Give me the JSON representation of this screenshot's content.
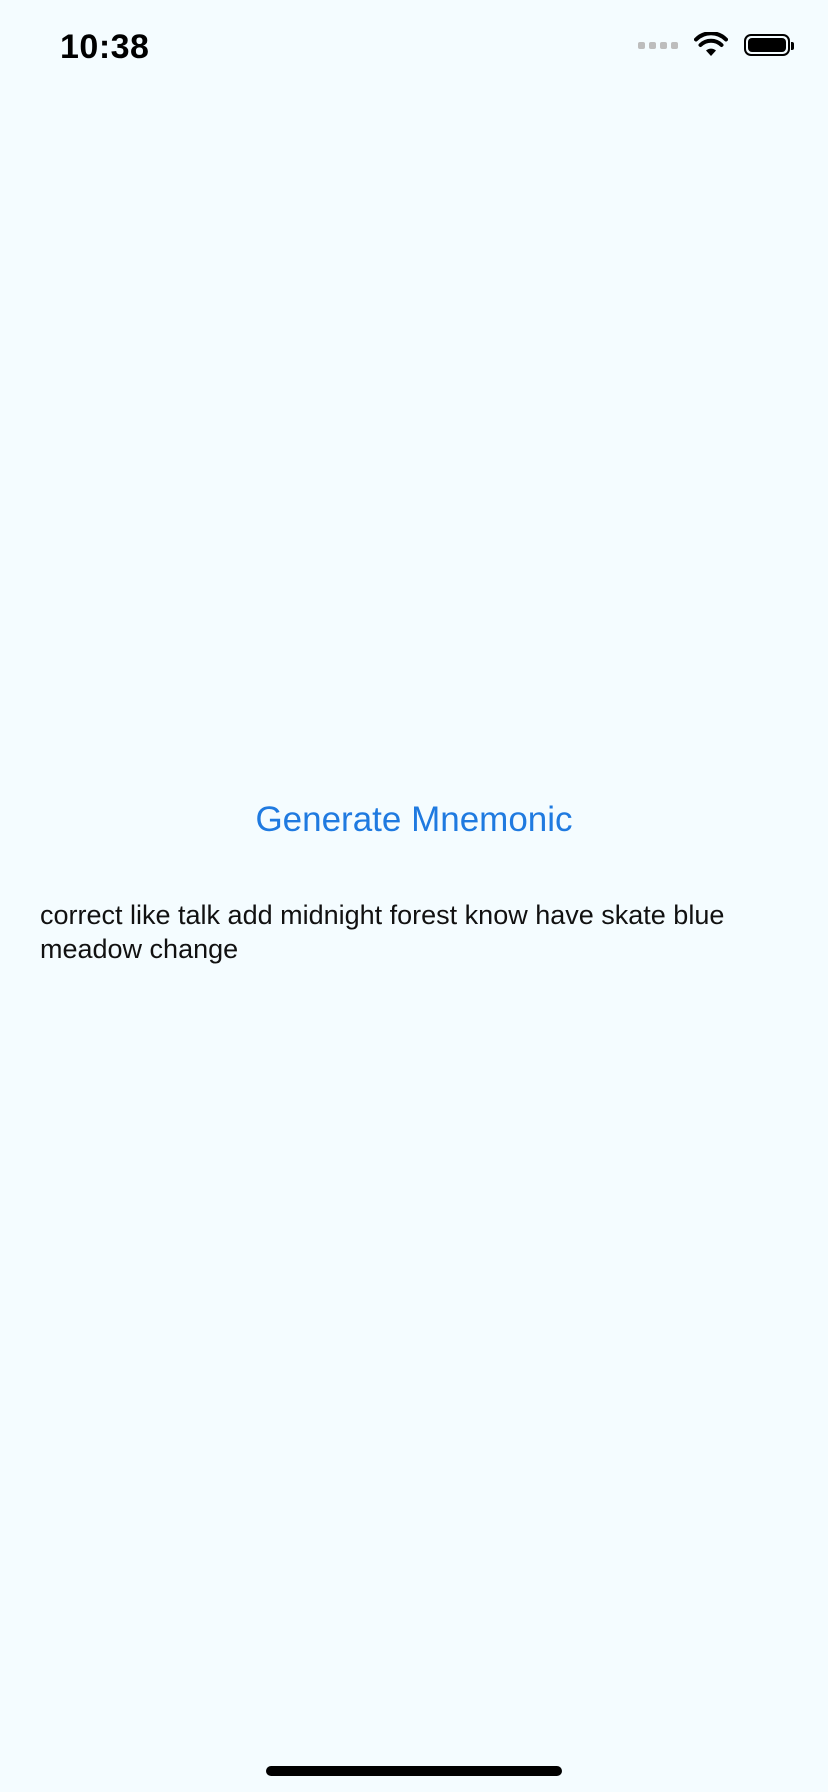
{
  "status_bar": {
    "time": "10:38",
    "icons": [
      "cellular-signal-icon",
      "wifi-icon",
      "battery-icon"
    ]
  },
  "main": {
    "generate_button_label": "Generate Mnemonic",
    "mnemonic_text": "correct like talk add midnight forest know have skate blue meadow change"
  },
  "colors": {
    "background": "#f4fcff",
    "accent": "#1f7ae0",
    "text": "#111111"
  }
}
